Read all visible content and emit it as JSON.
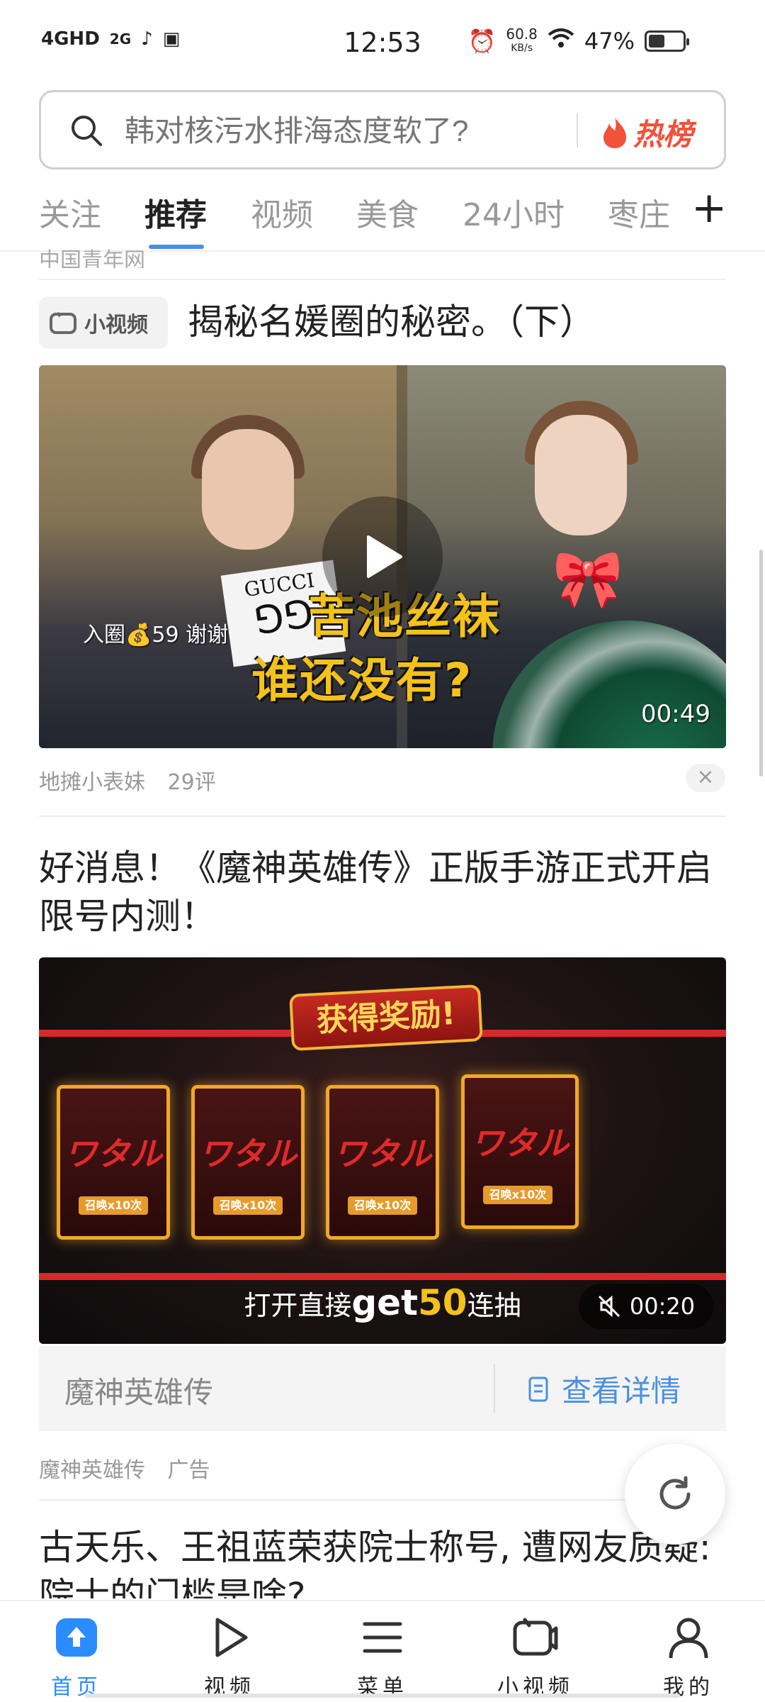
{
  "status_bar": {
    "network": "4GHD",
    "signal_2g": "2G",
    "time": "12:53",
    "speed_value": "60.8",
    "speed_unit": "KB/s",
    "battery": "47%",
    "battery_level": 0.47
  },
  "search": {
    "placeholder": "韩对核污水排海态度软了?",
    "hot_label": "热榜"
  },
  "tabs": [
    {
      "label": "关注"
    },
    {
      "label": "推荐"
    },
    {
      "label": "视频"
    },
    {
      "label": "美食"
    },
    {
      "label": "24小时"
    },
    {
      "label": "枣庄"
    }
  ],
  "tab_add": "+",
  "feed": {
    "prev_source": "中国青年网",
    "item1": {
      "tag": "小视频",
      "title": "揭秘名媛圈的秘密。（下）",
      "overlay_small": "入圈💰59 谢谢",
      "overlay_brand": "GUCCI",
      "overlay_caption_line1": "苦池丝袜",
      "overlay_caption_line2": "谁还没有?",
      "duration": "00:49",
      "author": "地摊小表妹",
      "comments": "29评",
      "close": "×"
    },
    "item2": {
      "title": "好消息！《魔神英雄传》正版手游正式开启限号内测！",
      "banner": "获得奖励!",
      "card_title": "ワタル",
      "card_tag": "召唤x10次",
      "ad_text_prefix": "打开直接",
      "ad_text_get": "get",
      "ad_text_num": "50",
      "ad_text_suffix": "连抽",
      "duration": "00:20",
      "footer_name": "魔神英雄传",
      "detail_button": "查看详情",
      "author": "魔神英雄传",
      "ad_label": "广告"
    },
    "item3": {
      "title": "古天乐、王祖蓝荣获院士称号, 遭网友质疑: 院士的门槛是啥?"
    }
  },
  "bottom_nav": [
    {
      "label": "首页",
      "icon": "home-icon"
    },
    {
      "label": "视频",
      "icon": "play-icon"
    },
    {
      "label": "菜单",
      "icon": "menu-icon"
    },
    {
      "label": "小视频",
      "icon": "short-video-icon"
    },
    {
      "label": "我的",
      "icon": "profile-icon"
    }
  ],
  "colors": {
    "accent": "#2a8cff",
    "hot": "#f2513a",
    "link": "#4a90e2"
  }
}
